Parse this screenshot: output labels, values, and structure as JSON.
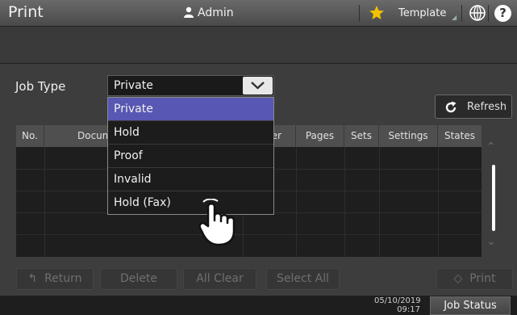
{
  "header": {
    "title": "Print",
    "user": "Admin",
    "template": "Template"
  },
  "job_type": {
    "label": "Job Type",
    "selected": "Private",
    "options": [
      "Private",
      "Hold",
      "Proof",
      "Invalid",
      "Hold (Fax)"
    ]
  },
  "refresh": {
    "label": "Refresh"
  },
  "table": {
    "columns": [
      "No.",
      "Docum",
      "per",
      "Pages",
      "Sets",
      "Settings",
      "States"
    ]
  },
  "buttons": {
    "return": "Return",
    "delete": "Delete",
    "all_clear": "All Clear",
    "select_all": "Select All",
    "print": "Print"
  },
  "status": {
    "date": "05/10/2019",
    "time": "09:17",
    "job_status": "Job Status"
  },
  "colors": {
    "selected_option": "#5857b3",
    "star": "#f2c200"
  }
}
